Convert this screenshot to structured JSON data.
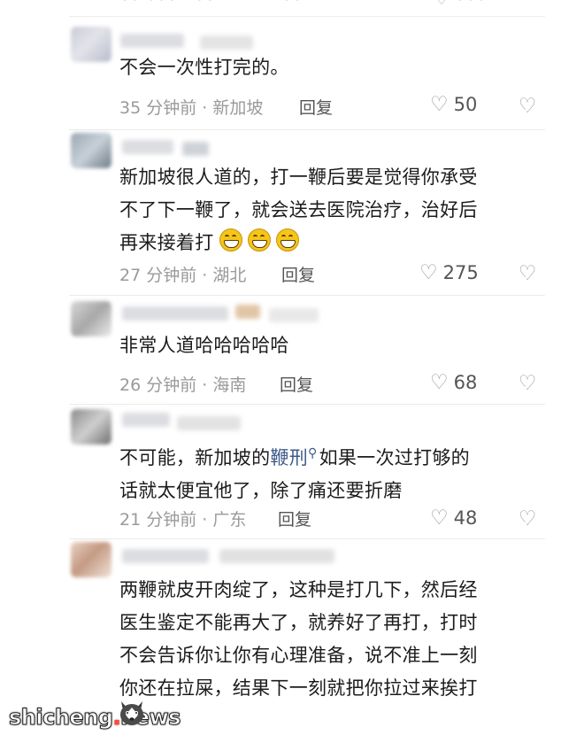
{
  "comments": [
    {
      "text": "不会一次性打完的。",
      "time": "35 分钟前",
      "location": "新加坡",
      "reply": "回复",
      "likes": "50"
    },
    {
      "text": "新加坡很人道的，打一鞭后要是觉得你承受\n不了下一鞭了，就会送去医院治疗，治好后\n再来接着打",
      "emojis": [
        "grin-emoji",
        "grin-emoji",
        "grin-emoji"
      ],
      "time": "27 分钟前",
      "location": "湖北",
      "reply": "回复",
      "likes": "275"
    },
    {
      "text": "非常人道哈哈哈哈哈",
      "time": "26 分钟前",
      "location": "海南",
      "reply": "回复",
      "likes": "68"
    },
    {
      "text_before": "不可能，新加坡的",
      "link": "鞭刑",
      "text_after": "如果一次过打够的\n话就太便宜他了，除了痛还要折磨",
      "time": "21 分钟前",
      "location": "广东",
      "reply": "回复",
      "likes": "48"
    },
    {
      "text": "两鞭就皮开肉绽了，这种是打几下，然后经\n医生鉴定不能再大了，就养好了再打，打时\n不会告诉你让你有心理准备，说不准上一刻\n你还在拉屎，结果下一刻就把你拉过来挨打"
    }
  ],
  "separator": " · ",
  "watermark": {
    "part1": "shicheng",
    "dot": ".",
    "part2": "news"
  },
  "colors": {
    "link": "#3f5b8a",
    "meta": "#9a9a9a",
    "text": "#1c1c1c"
  }
}
